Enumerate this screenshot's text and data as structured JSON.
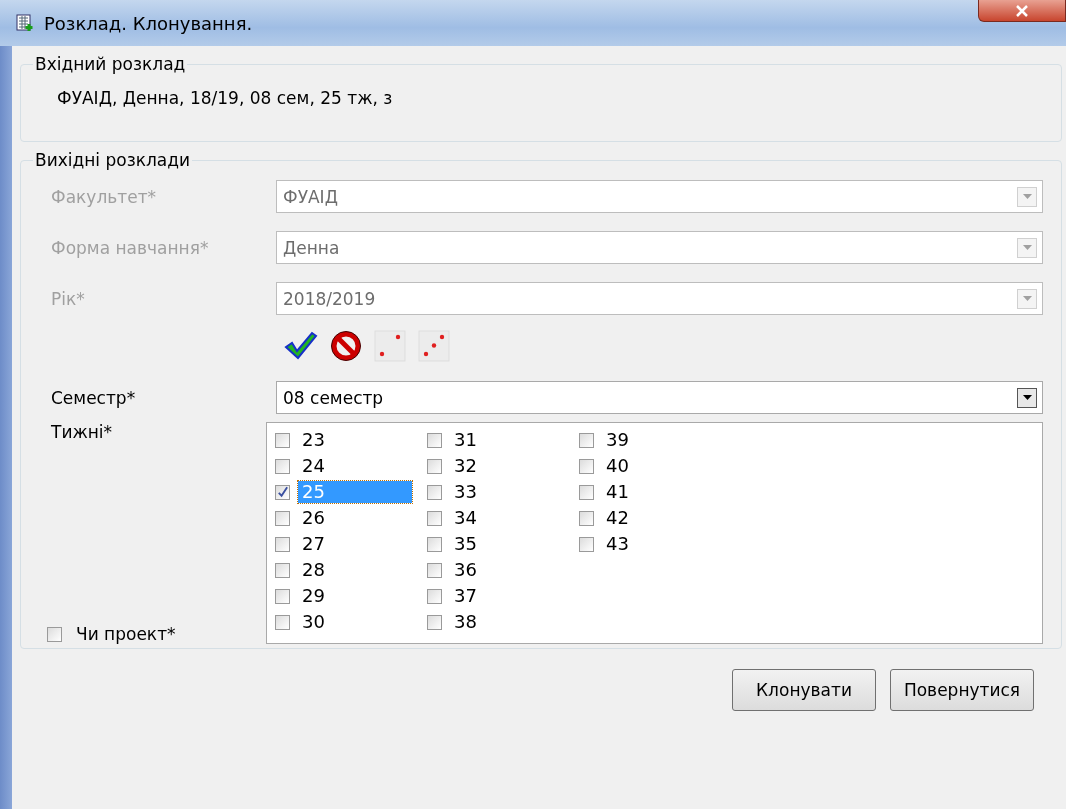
{
  "window": {
    "title": "Розклад. Клонування."
  },
  "input_group": {
    "legend": "Вхідний розклад",
    "value": "ФУАІД, Денна, 18/19, 08 сем, 25 тж, з"
  },
  "output_group": {
    "legend": "Вихідні розклади",
    "fields": [
      {
        "label": "Факультет*",
        "value": "ФУАІД",
        "disabled": true
      },
      {
        "label": "Форма навчання*",
        "value": "Денна",
        "disabled": true
      },
      {
        "label": "Рік*",
        "value": "2018/2019",
        "disabled": true
      }
    ],
    "semester": {
      "label": "Семестр*",
      "value": "08 семестр",
      "disabled": false
    },
    "weeks": {
      "label": "Тижні*",
      "items": [
        {
          "label": "23",
          "checked": false,
          "selected": false
        },
        {
          "label": "24",
          "checked": false,
          "selected": false
        },
        {
          "label": "25",
          "checked": true,
          "selected": true
        },
        {
          "label": "26",
          "checked": false,
          "selected": false
        },
        {
          "label": "27",
          "checked": false,
          "selected": false
        },
        {
          "label": "28",
          "checked": false,
          "selected": false
        },
        {
          "label": "29",
          "checked": false,
          "selected": false
        },
        {
          "label": "30",
          "checked": false,
          "selected": false
        },
        {
          "label": "31",
          "checked": false,
          "selected": false
        },
        {
          "label": "32",
          "checked": false,
          "selected": false
        },
        {
          "label": "33",
          "checked": false,
          "selected": false
        },
        {
          "label": "34",
          "checked": false,
          "selected": false
        },
        {
          "label": "35",
          "checked": false,
          "selected": false
        },
        {
          "label": "36",
          "checked": false,
          "selected": false
        },
        {
          "label": "37",
          "checked": false,
          "selected": false
        },
        {
          "label": "38",
          "checked": false,
          "selected": false
        },
        {
          "label": "39",
          "checked": false,
          "selected": false
        },
        {
          "label": "40",
          "checked": false,
          "selected": false
        },
        {
          "label": "41",
          "checked": false,
          "selected": false
        },
        {
          "label": "42",
          "checked": false,
          "selected": false
        },
        {
          "label": "43",
          "checked": false,
          "selected": false
        }
      ]
    },
    "project": {
      "label": "Чи проект*",
      "checked": false
    }
  },
  "buttons": [
    "Клонувати",
    "Повернутися"
  ]
}
